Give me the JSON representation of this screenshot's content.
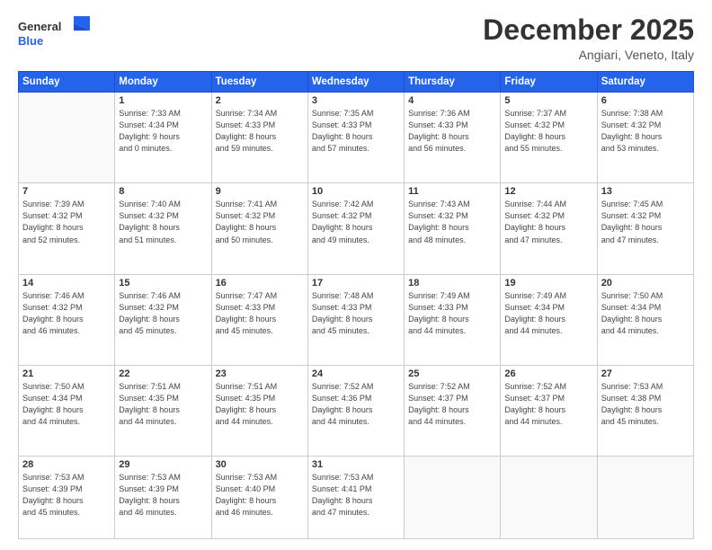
{
  "logo": {
    "general": "General",
    "blue": "Blue"
  },
  "header": {
    "month": "December 2025",
    "location": "Angiari, Veneto, Italy"
  },
  "weekdays": [
    "Sunday",
    "Monday",
    "Tuesday",
    "Wednesday",
    "Thursday",
    "Friday",
    "Saturday"
  ],
  "weeks": [
    [
      {
        "day": "",
        "info": ""
      },
      {
        "day": "1",
        "info": "Sunrise: 7:33 AM\nSunset: 4:34 PM\nDaylight: 9 hours\nand 0 minutes."
      },
      {
        "day": "2",
        "info": "Sunrise: 7:34 AM\nSunset: 4:33 PM\nDaylight: 8 hours\nand 59 minutes."
      },
      {
        "day": "3",
        "info": "Sunrise: 7:35 AM\nSunset: 4:33 PM\nDaylight: 8 hours\nand 57 minutes."
      },
      {
        "day": "4",
        "info": "Sunrise: 7:36 AM\nSunset: 4:33 PM\nDaylight: 8 hours\nand 56 minutes."
      },
      {
        "day": "5",
        "info": "Sunrise: 7:37 AM\nSunset: 4:32 PM\nDaylight: 8 hours\nand 55 minutes."
      },
      {
        "day": "6",
        "info": "Sunrise: 7:38 AM\nSunset: 4:32 PM\nDaylight: 8 hours\nand 53 minutes."
      }
    ],
    [
      {
        "day": "7",
        "info": "Sunrise: 7:39 AM\nSunset: 4:32 PM\nDaylight: 8 hours\nand 52 minutes."
      },
      {
        "day": "8",
        "info": "Sunrise: 7:40 AM\nSunset: 4:32 PM\nDaylight: 8 hours\nand 51 minutes."
      },
      {
        "day": "9",
        "info": "Sunrise: 7:41 AM\nSunset: 4:32 PM\nDaylight: 8 hours\nand 50 minutes."
      },
      {
        "day": "10",
        "info": "Sunrise: 7:42 AM\nSunset: 4:32 PM\nDaylight: 8 hours\nand 49 minutes."
      },
      {
        "day": "11",
        "info": "Sunrise: 7:43 AM\nSunset: 4:32 PM\nDaylight: 8 hours\nand 48 minutes."
      },
      {
        "day": "12",
        "info": "Sunrise: 7:44 AM\nSunset: 4:32 PM\nDaylight: 8 hours\nand 47 minutes."
      },
      {
        "day": "13",
        "info": "Sunrise: 7:45 AM\nSunset: 4:32 PM\nDaylight: 8 hours\nand 47 minutes."
      }
    ],
    [
      {
        "day": "14",
        "info": "Sunrise: 7:46 AM\nSunset: 4:32 PM\nDaylight: 8 hours\nand 46 minutes."
      },
      {
        "day": "15",
        "info": "Sunrise: 7:46 AM\nSunset: 4:32 PM\nDaylight: 8 hours\nand 45 minutes."
      },
      {
        "day": "16",
        "info": "Sunrise: 7:47 AM\nSunset: 4:33 PM\nDaylight: 8 hours\nand 45 minutes."
      },
      {
        "day": "17",
        "info": "Sunrise: 7:48 AM\nSunset: 4:33 PM\nDaylight: 8 hours\nand 45 minutes."
      },
      {
        "day": "18",
        "info": "Sunrise: 7:49 AM\nSunset: 4:33 PM\nDaylight: 8 hours\nand 44 minutes."
      },
      {
        "day": "19",
        "info": "Sunrise: 7:49 AM\nSunset: 4:34 PM\nDaylight: 8 hours\nand 44 minutes."
      },
      {
        "day": "20",
        "info": "Sunrise: 7:50 AM\nSunset: 4:34 PM\nDaylight: 8 hours\nand 44 minutes."
      }
    ],
    [
      {
        "day": "21",
        "info": "Sunrise: 7:50 AM\nSunset: 4:34 PM\nDaylight: 8 hours\nand 44 minutes."
      },
      {
        "day": "22",
        "info": "Sunrise: 7:51 AM\nSunset: 4:35 PM\nDaylight: 8 hours\nand 44 minutes."
      },
      {
        "day": "23",
        "info": "Sunrise: 7:51 AM\nSunset: 4:35 PM\nDaylight: 8 hours\nand 44 minutes."
      },
      {
        "day": "24",
        "info": "Sunrise: 7:52 AM\nSunset: 4:36 PM\nDaylight: 8 hours\nand 44 minutes."
      },
      {
        "day": "25",
        "info": "Sunrise: 7:52 AM\nSunset: 4:37 PM\nDaylight: 8 hours\nand 44 minutes."
      },
      {
        "day": "26",
        "info": "Sunrise: 7:52 AM\nSunset: 4:37 PM\nDaylight: 8 hours\nand 44 minutes."
      },
      {
        "day": "27",
        "info": "Sunrise: 7:53 AM\nSunset: 4:38 PM\nDaylight: 8 hours\nand 45 minutes."
      }
    ],
    [
      {
        "day": "28",
        "info": "Sunrise: 7:53 AM\nSunset: 4:39 PM\nDaylight: 8 hours\nand 45 minutes."
      },
      {
        "day": "29",
        "info": "Sunrise: 7:53 AM\nSunset: 4:39 PM\nDaylight: 8 hours\nand 46 minutes."
      },
      {
        "day": "30",
        "info": "Sunrise: 7:53 AM\nSunset: 4:40 PM\nDaylight: 8 hours\nand 46 minutes."
      },
      {
        "day": "31",
        "info": "Sunrise: 7:53 AM\nSunset: 4:41 PM\nDaylight: 8 hours\nand 47 minutes."
      },
      {
        "day": "",
        "info": ""
      },
      {
        "day": "",
        "info": ""
      },
      {
        "day": "",
        "info": ""
      }
    ]
  ]
}
